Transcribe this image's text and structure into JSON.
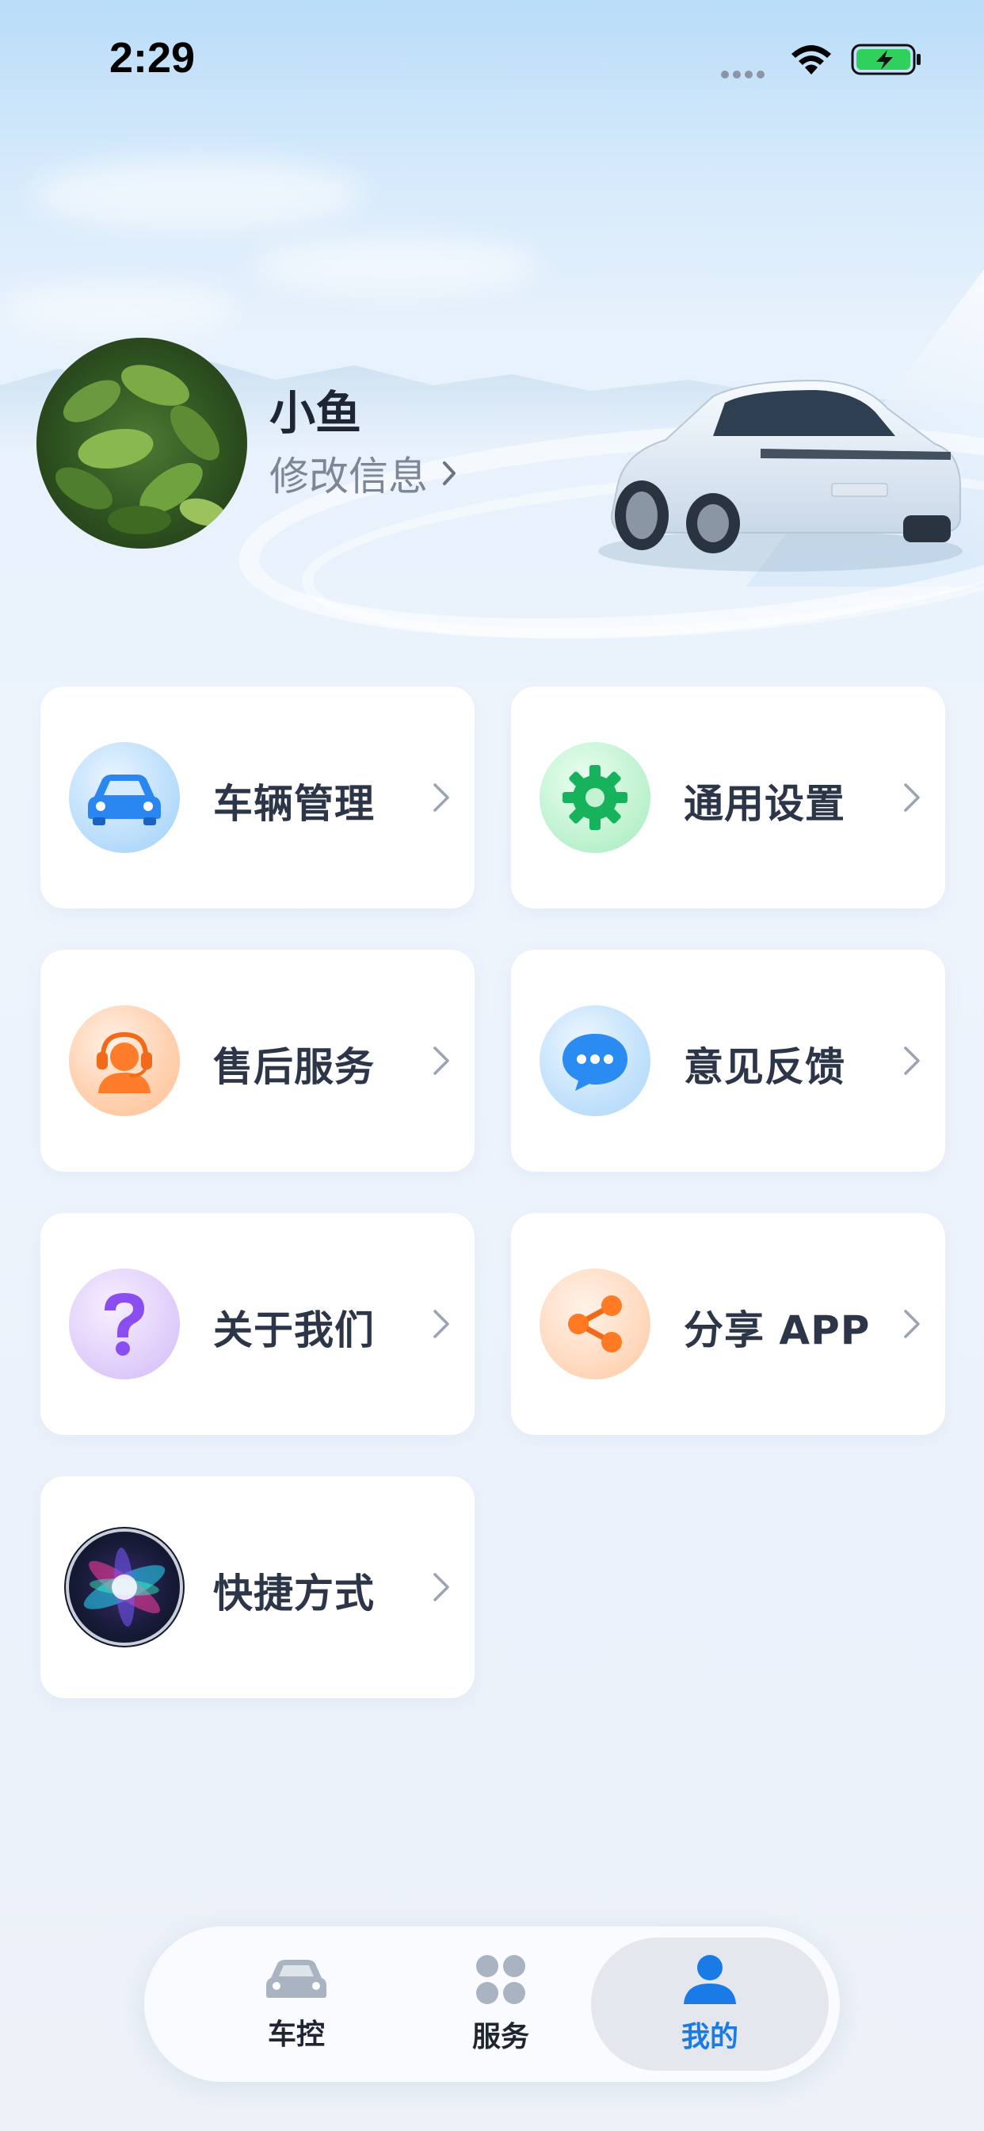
{
  "status_bar": {
    "time": "2:29"
  },
  "profile": {
    "name": "小鱼",
    "edit_label": "修改信息"
  },
  "menu": {
    "items": [
      {
        "label": "车辆管理",
        "icon": "car-icon"
      },
      {
        "label": "通用设置",
        "icon": "gear-icon"
      },
      {
        "label": "售后服务",
        "icon": "customer-service-icon"
      },
      {
        "label": "意见反馈",
        "icon": "chat-bubble-icon"
      },
      {
        "label": "关于我们",
        "icon": "question-icon"
      },
      {
        "label": "分享 APP",
        "icon": "share-icon"
      },
      {
        "label": "快捷方式",
        "icon": "siri-icon"
      }
    ]
  },
  "tabbar": {
    "tabs": [
      {
        "label": "车控",
        "icon": "car-control-icon"
      },
      {
        "label": "服务",
        "icon": "grid-icon"
      },
      {
        "label": "我的",
        "icon": "person-icon",
        "active": true
      }
    ]
  },
  "colors": {
    "accent": "#1a7ae6",
    "text_primary": "#2c3648",
    "text_secondary": "#7d8697"
  }
}
